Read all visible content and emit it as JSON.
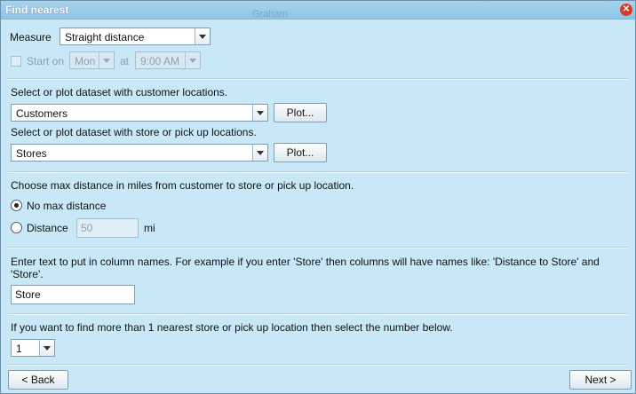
{
  "window": {
    "title": "Find nearest",
    "bg_map_label": "Graham"
  },
  "measure": {
    "label": "Measure",
    "value": "Straight distance"
  },
  "start": {
    "checkbox_label": "Start on",
    "day": "Mon",
    "at_label": "at",
    "time": "9:00 AM"
  },
  "customers": {
    "prompt": "Select or plot dataset with customer locations.",
    "value": "Customers",
    "plot_label": "Plot..."
  },
  "stores": {
    "prompt": "Select or plot dataset with store or pick up locations.",
    "value": "Stores",
    "plot_label": "Plot..."
  },
  "distance": {
    "prompt": "Choose max distance in miles from customer to store or pick up location.",
    "no_max_label": "No max distance",
    "distance_label": "Distance",
    "distance_value": "50",
    "unit": "mi"
  },
  "column_names": {
    "prompt_line1": "Enter text to put in column names. For example if you enter 'Store' then columns will have names like: 'Distance to Store' and",
    "prompt_line2": "'Store'.",
    "value": "Store"
  },
  "count": {
    "prompt": "If you want to find more than 1 nearest store or pick up location then select the number below.",
    "value": "1"
  },
  "nav": {
    "back_label": "< Back",
    "next_label": "Next >"
  }
}
